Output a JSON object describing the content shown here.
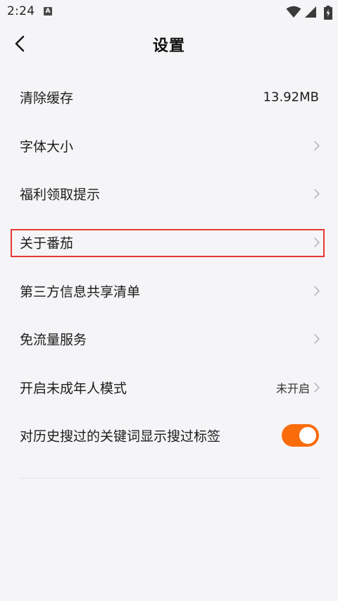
{
  "status_bar": {
    "time": "2:24",
    "notification_icon": "A",
    "icons": [
      "wifi-icon",
      "signal-icon",
      "battery-charging-icon"
    ]
  },
  "header": {
    "title": "设置",
    "back_icon": "chevron-left-icon"
  },
  "settings": {
    "clear_cache": {
      "label": "清除缓存",
      "value": "13.92MB"
    },
    "font_size": {
      "label": "字体大小"
    },
    "welfare_tips": {
      "label": "福利领取提示"
    },
    "about": {
      "label": "关于番茄"
    },
    "third_party": {
      "label": "第三方信息共享清单"
    },
    "free_data": {
      "label": "免流量服务"
    },
    "minor_mode": {
      "label": "开启未成年人模式",
      "value": "未开启"
    },
    "history_tags": {
      "label": "对历史搜过的关键词显示搜过标签",
      "enabled": true
    }
  },
  "colors": {
    "background": "#f5f5f7",
    "toggle_on": "#fa6b0c",
    "highlight_border": "#e53935",
    "chevron": "#b9b9bd"
  }
}
